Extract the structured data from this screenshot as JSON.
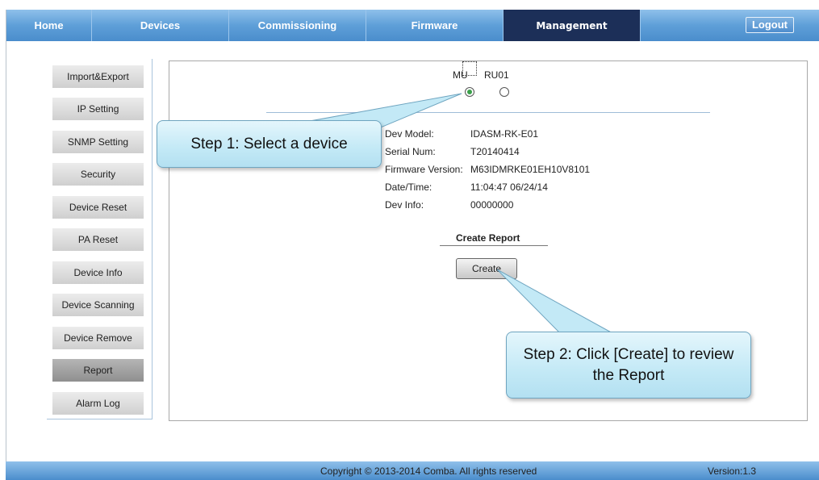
{
  "nav": {
    "tabs": [
      {
        "label": "Home"
      },
      {
        "label": "Devices"
      },
      {
        "label": "Commissioning"
      },
      {
        "label": "Firmware"
      },
      {
        "label": "Management"
      }
    ],
    "active_tab": "Management",
    "logout_label": "Logout"
  },
  "sidebar": {
    "items": [
      {
        "label": "Import&Export"
      },
      {
        "label": "IP Setting"
      },
      {
        "label": "SNMP Setting"
      },
      {
        "label": "Security"
      },
      {
        "label": "Device Reset"
      },
      {
        "label": "PA Reset"
      },
      {
        "label": "Device Info"
      },
      {
        "label": "Device Scanning"
      },
      {
        "label": "Device Remove"
      },
      {
        "label": "Report"
      },
      {
        "label": "Alarm Log"
      }
    ],
    "active_item": "Report"
  },
  "devices": {
    "options": [
      {
        "label": "MU",
        "checked": true
      },
      {
        "label": "RU01",
        "checked": false
      }
    ]
  },
  "info": {
    "rows": [
      {
        "label": "Dev Model:",
        "value": "IDASM-RK-E01"
      },
      {
        "label": "Serial Num:",
        "value": "T20140414"
      },
      {
        "label": "Firmware Version:",
        "value": "M63IDMRKE01EH10V8101"
      },
      {
        "label": "Date/Time:",
        "value": "11:04:47 06/24/14"
      },
      {
        "label": "Dev Info:",
        "value": "00000000"
      }
    ]
  },
  "report": {
    "title": "Create Report",
    "button_label": "Create"
  },
  "callouts": {
    "step1": "Step 1: Select a device",
    "step2": "Step 2: Click [Create] to review the Report"
  },
  "footer": {
    "copyright": "Copyright © 2013-2014 Comba. All rights reserved",
    "version": "Version:1.3"
  },
  "colors": {
    "nav_blue": "#5e9fd8",
    "nav_active": "#1c2f58",
    "callout_fill": "#c3e9f6",
    "radio_checked": "#3aa04a"
  }
}
